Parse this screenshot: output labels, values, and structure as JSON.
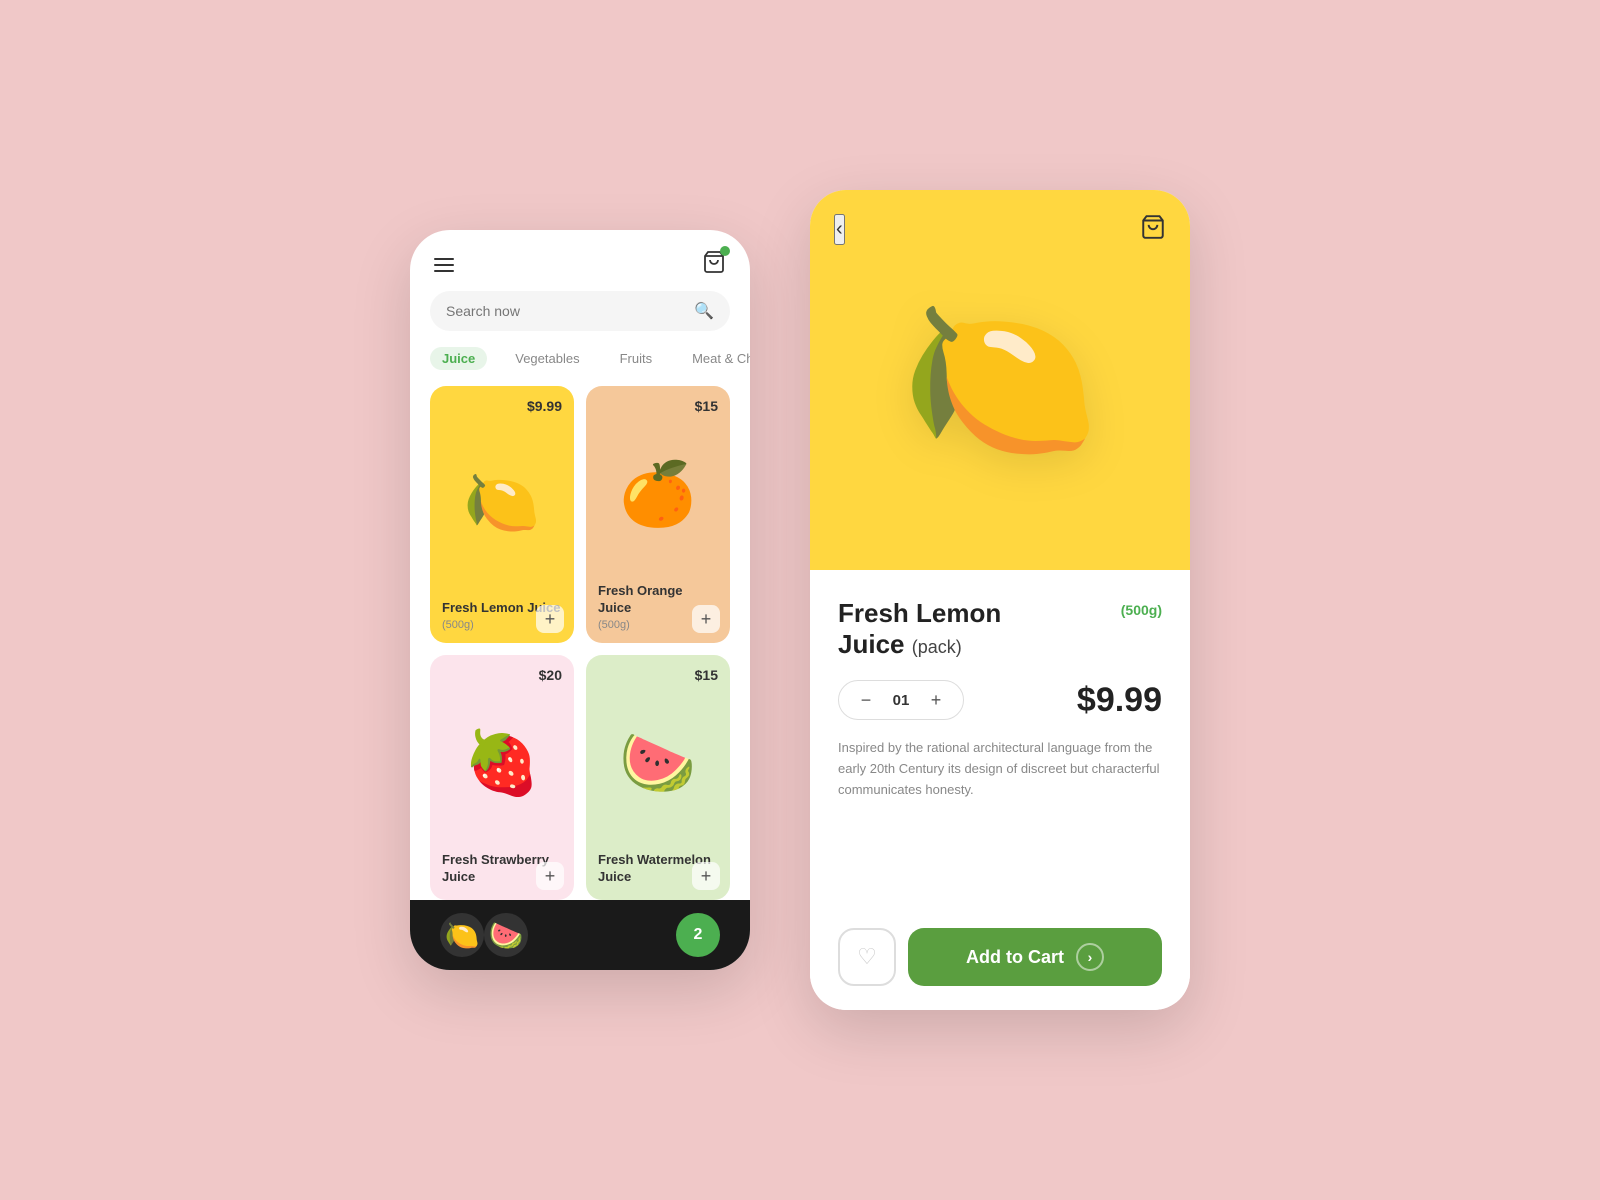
{
  "background_color": "#f0c8c8",
  "phone1": {
    "header": {
      "cart_badge_color": "#4caf50"
    },
    "search": {
      "placeholder": "Search now"
    },
    "categories": [
      {
        "label": "Juice",
        "active": true
      },
      {
        "label": "Vegetables",
        "active": false
      },
      {
        "label": "Fruits",
        "active": false
      },
      {
        "label": "Meat & Chic",
        "active": false
      }
    ],
    "products": [
      {
        "id": "lemon",
        "name": "Fresh Lemon Juice",
        "price": "$9.99",
        "weight": "(500g)",
        "bg": "yellow",
        "emoji": "🍋"
      },
      {
        "id": "orange",
        "name": "Fresh Orange Juice",
        "price": "$15",
        "weight": "(500g)",
        "bg": "peach",
        "emoji": "🍊"
      },
      {
        "id": "strawberry",
        "name": "Fresh Strawberry Juice",
        "price": "$20",
        "weight": "",
        "bg": "pink",
        "emoji": "🍓"
      },
      {
        "id": "watermelon",
        "name": "Fresh Watermelon Juice",
        "price": "$15",
        "weight": "",
        "bg": "green",
        "emoji": "🍉"
      }
    ],
    "bottom": {
      "cart_count": "2"
    }
  },
  "phone2": {
    "hero_bg": "#ffd740",
    "product": {
      "name": "Fresh Lemon",
      "name2": "Juice",
      "pack_label": "(pack)",
      "weight": "(500g)",
      "price": "$9.99",
      "quantity": "01",
      "description": "Inspired by the rational architectural language from the early 20th Century its design of discreet but characterful communicates honesty.",
      "emoji": "🍋"
    },
    "add_to_cart_label": "Add to Cart"
  }
}
